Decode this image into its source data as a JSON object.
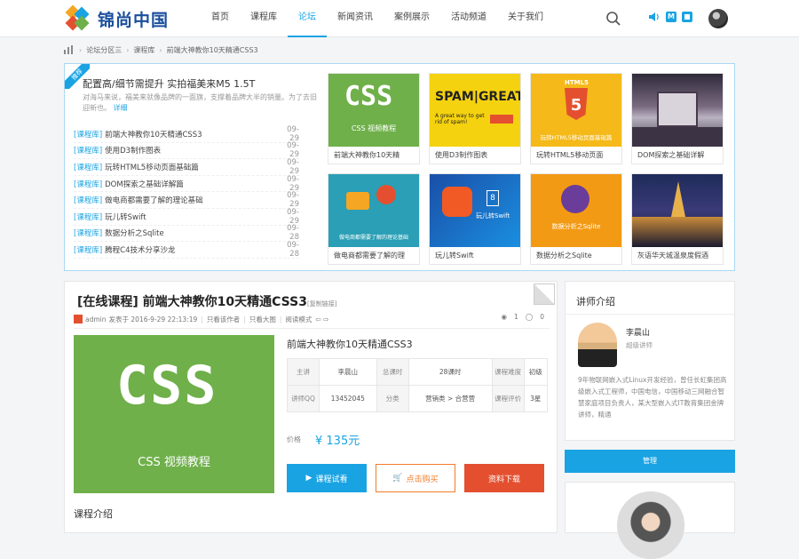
{
  "logo": {
    "text": "锦尚中国",
    "colors": [
      "#f5a623",
      "#1aa3e3",
      "#e4502f",
      "#6fb04a"
    ]
  },
  "nav": [
    {
      "label": "首页",
      "active": false
    },
    {
      "label": "课程库",
      "active": false
    },
    {
      "label": "论坛",
      "active": true
    },
    {
      "label": "新闻资讯",
      "active": false
    },
    {
      "label": "案例展示",
      "active": false
    },
    {
      "label": "活动频道",
      "active": false
    },
    {
      "label": "关于我们",
      "active": false
    }
  ],
  "header_icons": {
    "search": "search-icon",
    "volume": "volume-icon",
    "grid": "grid-icon",
    "message": "M",
    "avatar": "user-avatar"
  },
  "breadcrumb": [
    "论坛分区三",
    "课程库",
    "前端大神教你10天精通CSS3"
  ],
  "featured": {
    "ribbon": "推荐",
    "title": "配置高/细节需提升 实拍福美来M5 1.5T",
    "desc": "对海马来说，福美来就像品牌的一面旗，支撑着品牌大半的销量。为了去旧迎新也。",
    "more": "详细"
  },
  "news": [
    {
      "tag": "[课程库]",
      "text": "前端大神教你10天精通CSS3",
      "date": "09-29"
    },
    {
      "tag": "[课程库]",
      "text": "使用D3制作图表",
      "date": "09-29"
    },
    {
      "tag": "[课程库]",
      "text": "玩转HTML5移动页面基础篇",
      "date": "09-29"
    },
    {
      "tag": "[课程库]",
      "text": "DOM探索之基础详解篇",
      "date": "09-29"
    },
    {
      "tag": "[课程库]",
      "text": "做电商都需要了解的理论基础",
      "date": "09-29"
    },
    {
      "tag": "[课程库]",
      "text": "玩儿转Swift",
      "date": "09-29"
    },
    {
      "tag": "[课程库]",
      "text": "数据分析之Sqlite",
      "date": "09-28"
    },
    {
      "tag": "[课程库]",
      "text": "腾程C4技术分享沙龙",
      "date": "09-28"
    }
  ],
  "thumbs": [
    {
      "caption": "前端大神教你10天精",
      "bg": "#6fb04a",
      "label": "CSS",
      "sub": "CSS 视频教程"
    },
    {
      "caption": "使用D3制作图表",
      "bg": "#f5d20f",
      "label": "SPAM|GREAT!",
      "sub": "A great way to get rid of spam!"
    },
    {
      "caption": "玩转HTML5移动页面",
      "bg": "#f5b91a",
      "label": "HTML5",
      "sub": "玩转HTML5移动页面基础篇"
    },
    {
      "caption": "DOM探索之基础详解",
      "bg": "#5a4a66",
      "label": "",
      "sub": ""
    },
    {
      "caption": "做电商都需要了解的理",
      "bg": "#2a9fb5",
      "label": "",
      "sub": "做电商都需要了解的理论基础"
    },
    {
      "caption": "玩儿转Swift",
      "bg": "#1a6fd1",
      "label": "8",
      "sub": "玩儿转Swift"
    },
    {
      "caption": "数据分析之Sqlite",
      "bg": "#f39a14",
      "label": "",
      "sub": "数据分析之Sqlite"
    },
    {
      "caption": "灰语华天城温泉度假酒",
      "bg": "#1e2c5a",
      "label": "",
      "sub": ""
    }
  ],
  "article": {
    "title": "[在线课程] 前端大神教你10天精通CSS3",
    "copy_link": "[复制链接]",
    "author": "admin",
    "published": "发表于 2016-9-29 22:13:19",
    "only_author": "只看该作者",
    "only_large": "只看大图",
    "read_mode": "阅读模式",
    "views": "1",
    "replies": "0",
    "cover_label": "CSS",
    "cover_sub": "CSS 视频教程",
    "course_name": "前端大神教你10天精通CSS3",
    "table": [
      [
        {
          "k": "主讲",
          "v": "李晨山"
        },
        {
          "k": "总课时",
          "v": "28课时"
        },
        {
          "k": "课程难度",
          "v": "初级"
        }
      ],
      [
        {
          "k": "讲师QQ",
          "v": "13452045"
        },
        {
          "k": "分类",
          "v": "营销类 > 合营营"
        },
        {
          "k": "课程评价",
          "v": "3星"
        }
      ]
    ],
    "price_label": "价格",
    "price": "¥ 135元",
    "btn_trial": "课程试看",
    "btn_buy": "点击购买",
    "btn_download": "资料下载",
    "intro_label": "课程介绍"
  },
  "sidebar": {
    "title": "讲师介绍",
    "teacher_name": "李晨山",
    "teacher_role": "超级讲师",
    "bio": "9年物联网嵌入式Linux开发经验，曾任长虹集团高级嵌入式工程师，中国电信，中国移动三网融合智慧家庭项目负责人，某大型嵌入式IT教育集团金牌讲师，精通",
    "manage_btn": "管理"
  }
}
